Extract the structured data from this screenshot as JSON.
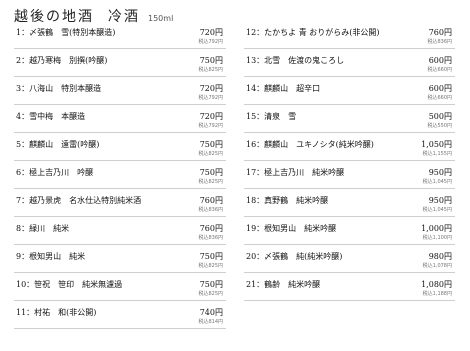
{
  "header": {
    "title": "越後の地酒",
    "subtitle": "冷酒",
    "volume": "150ml"
  },
  "left_items": [
    {
      "name": "1：〆張鶴　雪(特別本醸造)",
      "price": "720円",
      "tax": "税込792円"
    },
    {
      "name": "2：越乃寒梅　別撰(吟醸)",
      "price": "750円",
      "tax": "税込825円"
    },
    {
      "name": "3：八海山　特別本醸造",
      "price": "720円",
      "tax": "税込792円"
    },
    {
      "name": "4：雪中梅　本醸造",
      "price": "720円",
      "tax": "税込792円"
    },
    {
      "name": "5：麒麟山　遠雷(吟醸)",
      "price": "750円",
      "tax": "税込825円"
    },
    {
      "name": "6：極上吉乃川　吟醸",
      "price": "750円",
      "tax": "税込825円"
    },
    {
      "name": "7：越乃景虎　名水仕込特別純米酒",
      "price": "760円",
      "tax": "税込836円"
    },
    {
      "name": "8：緑川　純米",
      "price": "760円",
      "tax": "税込836円"
    },
    {
      "name": "9：根知男山　純米",
      "price": "750円",
      "tax": "税込825円"
    },
    {
      "name": "10：笹祝　笹印　純米無濾過",
      "price": "750円",
      "tax": "税込825円"
    },
    {
      "name": "11：村祐　和(非公開)",
      "price": "740円",
      "tax": "税込814円"
    }
  ],
  "right_items": [
    {
      "name": "12：たかちよ 青 おりがらみ(非公開)",
      "price": "760円",
      "tax": "税込836円"
    },
    {
      "name": "13：北雪　佐渡の鬼ころし",
      "price": "600円",
      "tax": "税込660円"
    },
    {
      "name": "14：麒麟山　超辛口",
      "price": "600円",
      "tax": "税込660円"
    },
    {
      "name": "15：清泉　雪",
      "price": "500円",
      "tax": "税込550円"
    },
    {
      "name": "16：麒麟山　ユキノシタ(純米吟醸)",
      "price": "1,050円",
      "tax": "税込1,155円"
    },
    {
      "name": "17：極上吉乃川　純米吟醸",
      "price": "950円",
      "tax": "税込1,045円"
    },
    {
      "name": "18：真野鶴　純米吟醸",
      "price": "950円",
      "tax": "税込1,045円"
    },
    {
      "name": "19：根知男山　純米吟醸",
      "price": "1,000円",
      "tax": "税込1,100円"
    },
    {
      "name": "20：〆張鶴　純(純米吟醸)",
      "price": "980円",
      "tax": "税込1,078円"
    },
    {
      "name": "21：鶴齢　純米吟醸",
      "price": "1,080円",
      "tax": "税込1,188円"
    }
  ]
}
